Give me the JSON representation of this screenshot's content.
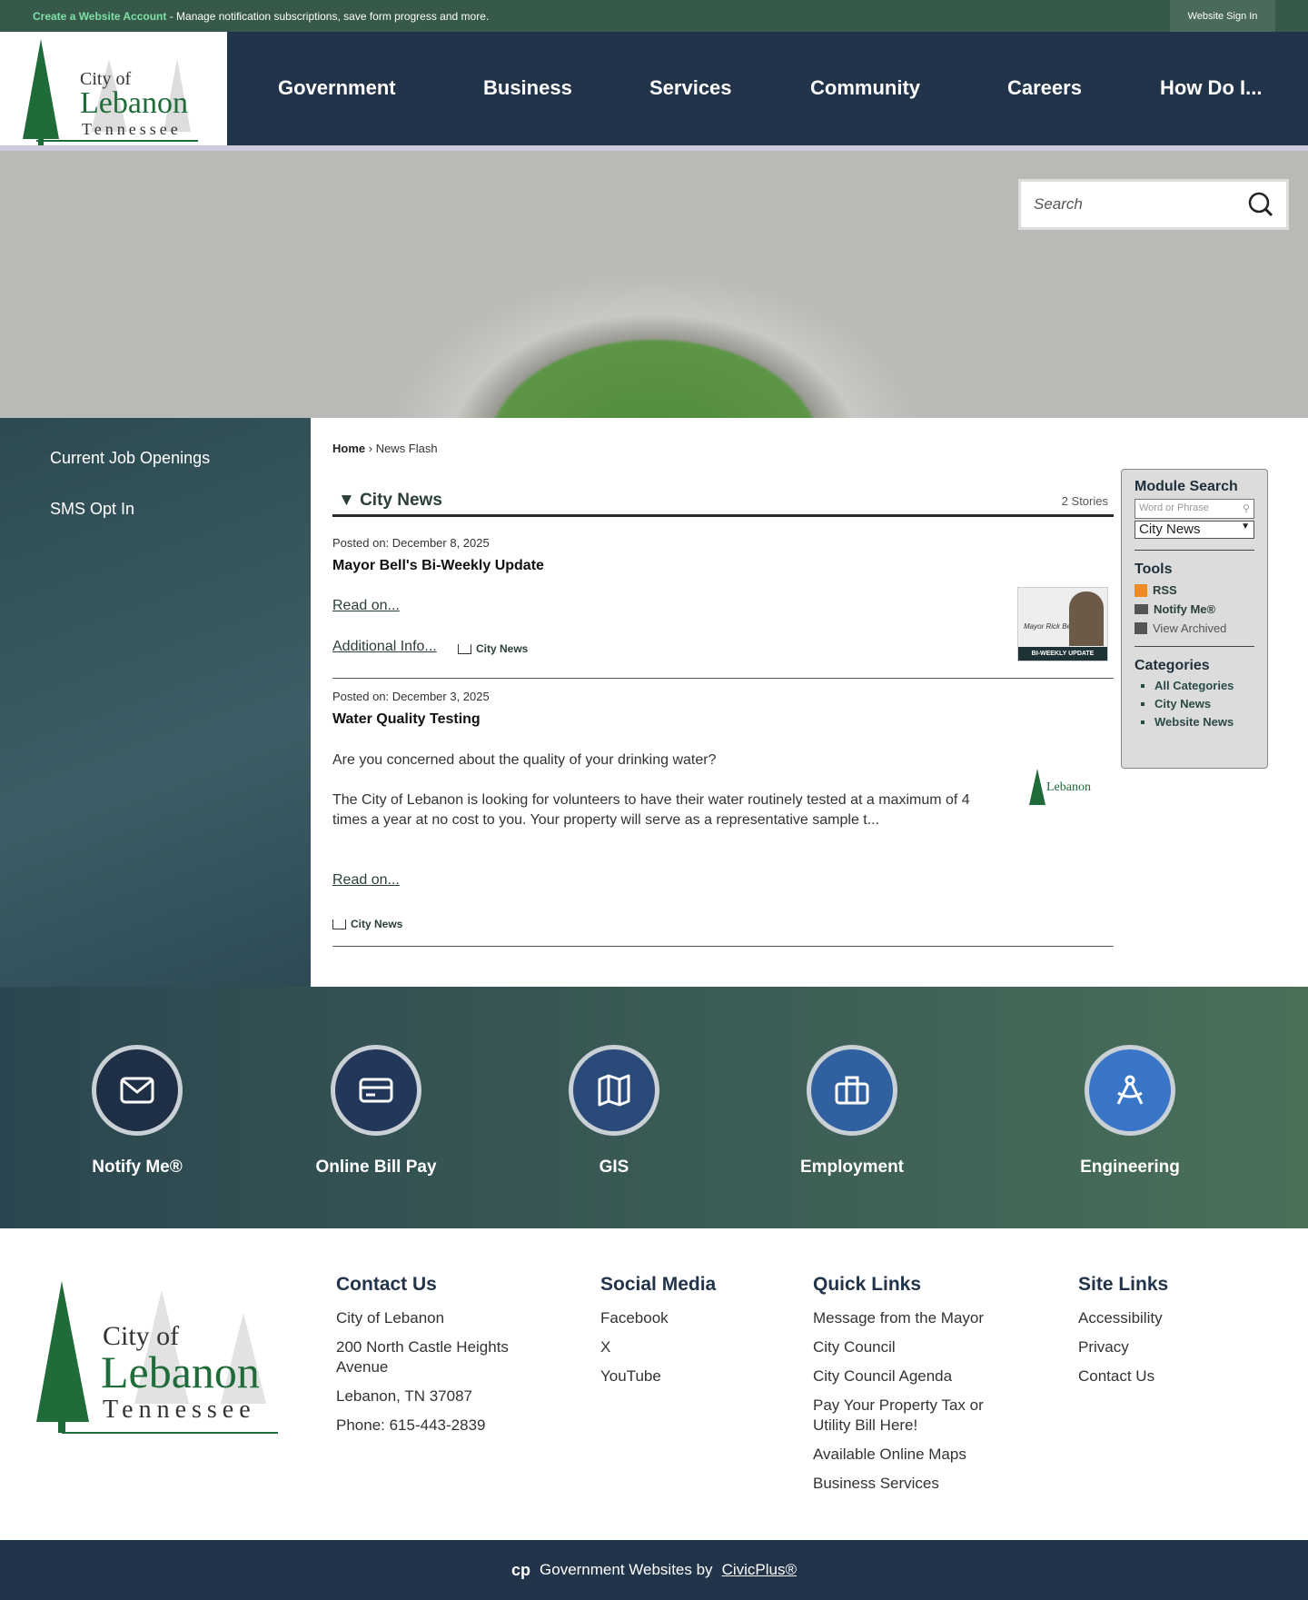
{
  "topbar": {
    "create_account": "Create a Website Account",
    "create_desc": " - Manage notification subscriptions, save form progress and more.",
    "sign_in": "Website Sign In"
  },
  "logo": {
    "line1": "City of",
    "line2": "Lebanon",
    "line3": "Tennessee"
  },
  "nav": [
    "Government",
    "Business",
    "Services",
    "Community",
    "Careers",
    "How Do I..."
  ],
  "search": {
    "placeholder": "Search"
  },
  "sidebar": [
    "Current Job Openings",
    "SMS Opt In"
  ],
  "breadcrumb": {
    "home": "Home",
    "sep": " › ",
    "current": "News Flash"
  },
  "news": {
    "heading": "▼ City News",
    "count": "2 Stories",
    "items": [
      {
        "posted": "Posted on: December 8, 2025",
        "title": "Mayor Bell's Bi-Weekly Update",
        "read": "Read on...",
        "additional": "Additional Info...",
        "category": "City News",
        "thumb_caption": "BI-WEEKLY UPDATE",
        "thumb_sig": "Mayor Rick Bell"
      },
      {
        "posted": "Posted on: December 3, 2025",
        "title": "Water Quality Testing",
        "p1": "Are you concerned about the quality of your drinking water?",
        "p2": "The City of Lebanon is looking for volunteers to have their water routinely tested at a maximum of 4 times a year at no cost to you. Your property will serve as a representative sample t...",
        "read": "Read on...",
        "category": "City News"
      }
    ]
  },
  "module": {
    "title": "Module Search",
    "placeholder": "Word or Phrase",
    "select": "City News",
    "tools_title": "Tools",
    "tools": [
      "RSS",
      "Notify Me®",
      "View Archived"
    ],
    "cat_title": "Categories",
    "categories": [
      "All Categories",
      "City News",
      "Website News"
    ]
  },
  "quick": [
    "Notify Me®",
    "Online Bill Pay",
    "GIS",
    "Employment",
    "Engineering"
  ],
  "footer": {
    "contact": {
      "title": "Contact Us",
      "lines": [
        "City of Lebanon",
        "200 North Castle Heights Avenue",
        "Lebanon, TN 37087",
        "Phone: 615-443-2839"
      ]
    },
    "social": {
      "title": "Social Media",
      "links": [
        "Facebook",
        "X",
        "YouTube"
      ]
    },
    "quick": {
      "title": "Quick Links",
      "links": [
        "Message from the Mayor",
        "City Council",
        "City Council Agenda",
        "Pay Your Property Tax or Utility Bill Here!",
        "Available Online Maps",
        "Business Services"
      ]
    },
    "site": {
      "title": "Site Links",
      "links": [
        "Accessibility",
        "Privacy",
        "Contact Us"
      ]
    }
  },
  "bottom": {
    "text": "Government Websites by",
    "link": "CivicPlus®"
  }
}
